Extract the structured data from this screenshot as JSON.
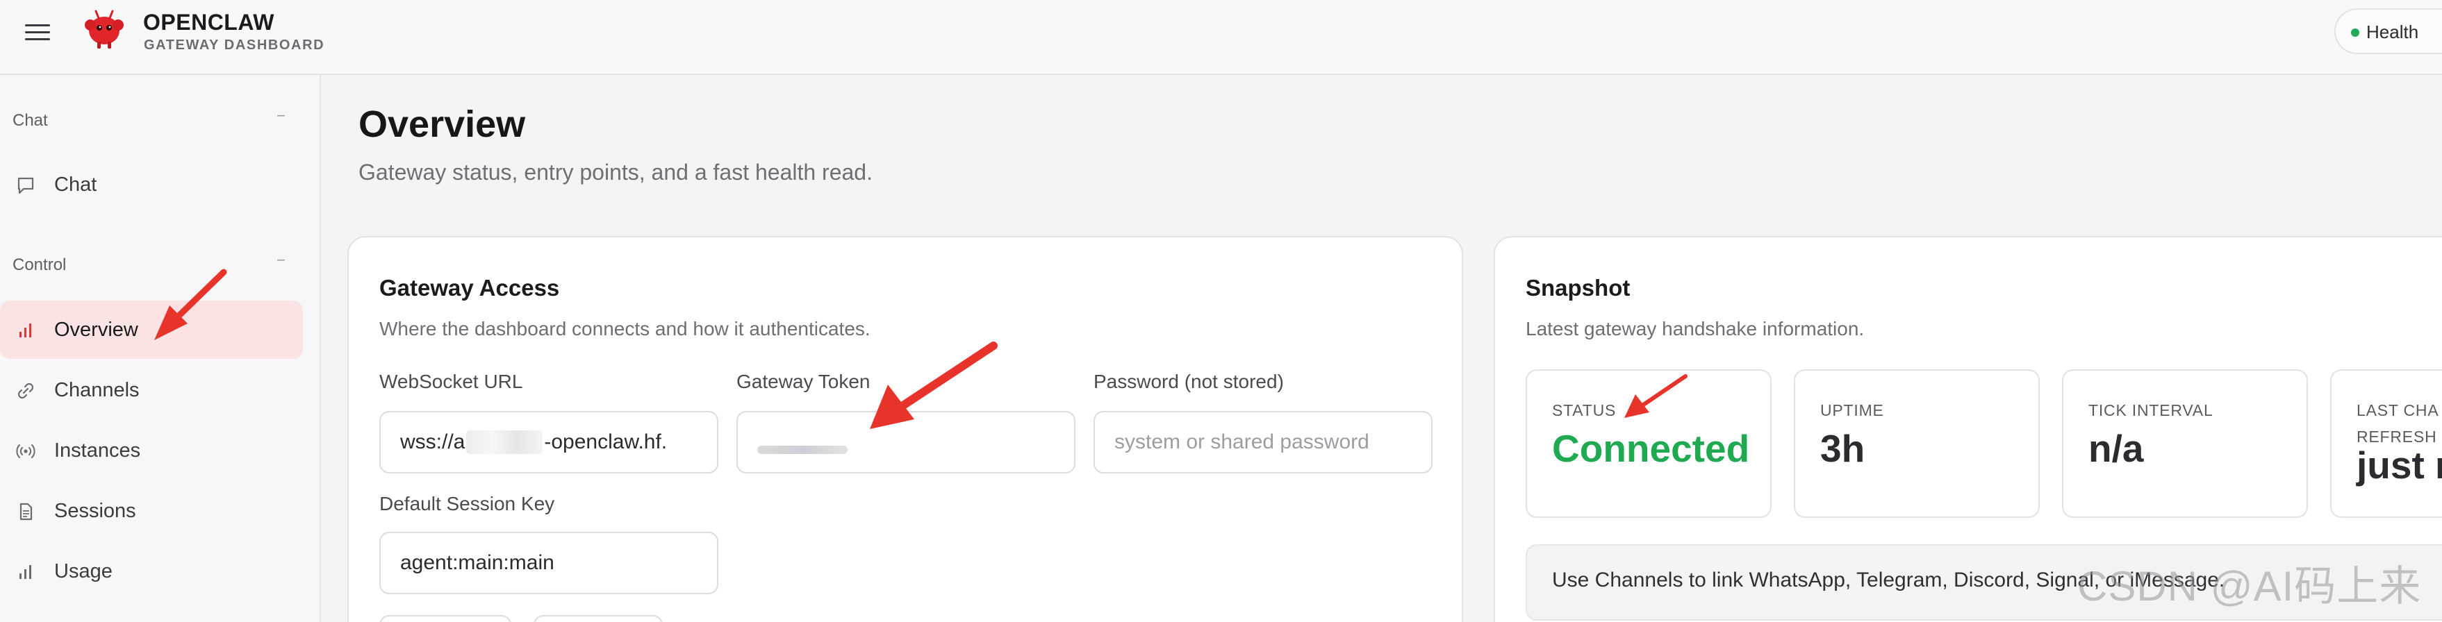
{
  "header": {
    "brand_title": "OPENCLAW",
    "brand_subtitle": "GATEWAY DASHBOARD",
    "health_label": "Health",
    "health_color": "#22a85a"
  },
  "sidebar": {
    "groups": [
      {
        "label": "Chat",
        "collapse": "−",
        "items": [
          {
            "label": "Chat",
            "icon": "chat-bubble-icon"
          }
        ]
      },
      {
        "label": "Control",
        "collapse": "−",
        "items": [
          {
            "label": "Overview",
            "icon": "bar-chart-icon",
            "active": true
          },
          {
            "label": "Channels",
            "icon": "link-icon"
          },
          {
            "label": "Instances",
            "icon": "broadcast-icon"
          },
          {
            "label": "Sessions",
            "icon": "document-icon"
          },
          {
            "label": "Usage",
            "icon": "bar-chart-icon"
          }
        ]
      }
    ]
  },
  "main": {
    "title": "Overview",
    "subtitle": "Gateway status, entry points, and a fast health read."
  },
  "gateway_access": {
    "title": "Gateway Access",
    "subtitle": "Where the dashboard connects and how it authenticates.",
    "websocket_label": "WebSocket URL",
    "websocket_prefix": "wss://a",
    "websocket_suffix": "-openclaw.hf.",
    "token_label": "Gateway Token",
    "password_label": "Password (not stored)",
    "password_placeholder": "system or shared password",
    "session_key_label": "Default Session Key",
    "session_key_value": "agent:main:main"
  },
  "snapshot": {
    "title": "Snapshot",
    "subtitle": "Latest gateway handshake information.",
    "stats": [
      {
        "label": "STATUS",
        "value": "Connected",
        "color": "#1faa52"
      },
      {
        "label": "UPTIME",
        "value": "3h"
      },
      {
        "label": "TICK INTERVAL",
        "value": "n/a"
      },
      {
        "label": "LAST CHANNELS REFRESH",
        "label_line1": "LAST CHA",
        "label_line2": "REFRESH",
        "value": "just n"
      }
    ],
    "hint": "Use Channels to link WhatsApp, Telegram, Discord, Signal, or iMessage."
  },
  "watermark": "CSDN @AI码上来",
  "annotation_color": "#e8332b"
}
